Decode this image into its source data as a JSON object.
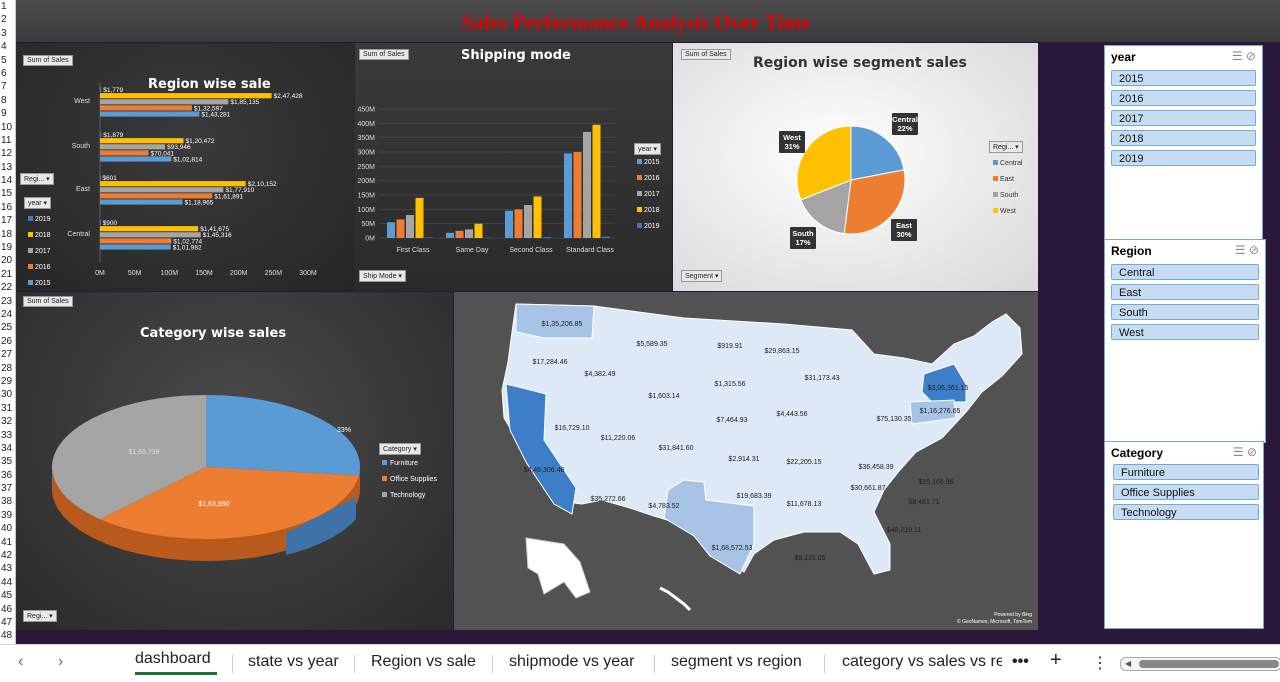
{
  "dashboard_title": "Sales Performance Analysis Over Time",
  "row_numbers": [
    "1",
    "2",
    "3",
    "4",
    "5",
    "6",
    "7",
    "8",
    "9",
    "10",
    "11",
    "12",
    "13",
    "14",
    "15",
    "16",
    "17",
    "18",
    "19",
    "20",
    "21",
    "22",
    "23",
    "24",
    "25",
    "26",
    "27",
    "28",
    "29",
    "30",
    "31",
    "32",
    "33",
    "34",
    "35",
    "36",
    "37",
    "38",
    "39",
    "40",
    "41",
    "42",
    "43",
    "44",
    "45",
    "46",
    "47",
    "48"
  ],
  "region_chart": {
    "field_button": "Sum of Sales",
    "title": "Region wise sale",
    "row_button": "Regi... ▾",
    "legend_button": "year ▾",
    "years": [
      "2019",
      "2018",
      "2017",
      "2016",
      "2015"
    ],
    "year_colors": {
      "2019": "#4472c4",
      "2018": "#ffc000",
      "2017": "#a5a5a5",
      "2016": "#ed7d31",
      "2015": "#5b9bd5"
    },
    "x_ticks": [
      "0M",
      "50M",
      "100M",
      "150M",
      "200M",
      "250M",
      "300M"
    ],
    "chart_data": {
      "type": "bar",
      "orientation": "horizontal",
      "categories": [
        "West",
        "South",
        "East",
        "Central"
      ],
      "series": [
        {
          "name": "2019",
          "values": [
            1779,
            1879,
            601,
            900
          ]
        },
        {
          "name": "2018",
          "values": [
            247428,
            120472,
            210152,
            141675
          ]
        },
        {
          "name": "2017",
          "values": [
            185135,
            93946,
            177910,
            145316
          ]
        },
        {
          "name": "2016",
          "values": [
            132597,
            70041,
            161891,
            102774
          ]
        },
        {
          "name": "2015",
          "values": [
            143281,
            102814,
            118965,
            101982
          ]
        }
      ],
      "labels": [
        [
          "$1,779",
          "$2,47,428",
          "$1,85,135",
          "$1,32,597",
          "$1,43,281"
        ],
        [
          "$1,879",
          "$1,20,472",
          "$93,946",
          "$70,041",
          "$1,02,814"
        ],
        [
          "$601",
          "$2,10,152",
          "$1,77,910",
          "$1,61,891",
          "$1,18,965"
        ],
        [
          "$900",
          "$1,41,675",
          "$1,45,316",
          "$1,02,774",
          "$1,01,982"
        ]
      ]
    }
  },
  "shipping_chart": {
    "field_button": "Sum of Sales",
    "title": "Shipping mode",
    "axis_button": "Ship Mode ▾",
    "legend_button": "year ▾",
    "y_ticks": [
      "0M",
      "50M",
      "100M",
      "150M",
      "200M",
      "250M",
      "300M",
      "350M",
      "400M",
      "450M"
    ],
    "legend": [
      "2015",
      "2016",
      "2017",
      "2018",
      "2019"
    ],
    "colors": [
      "#5b9bd5",
      "#ed7d31",
      "#a5a5a5",
      "#ffc000",
      "#4472c4"
    ],
    "chart_data": {
      "type": "bar",
      "categories": [
        "First Class",
        "Same Day",
        "Second Class",
        "Standard Class"
      ],
      "ylim": [
        0,
        450
      ],
      "series": [
        {
          "name": "2015",
          "values": [
            55,
            18,
            95,
            295
          ]
        },
        {
          "name": "2016",
          "values": [
            65,
            25,
            100,
            300
          ]
        },
        {
          "name": "2017",
          "values": [
            80,
            30,
            115,
            370
          ]
        },
        {
          "name": "2018",
          "values": [
            140,
            50,
            145,
            395
          ]
        },
        {
          "name": "2019",
          "values": [
            2,
            1,
            3,
            5
          ]
        }
      ]
    }
  },
  "segment_chart": {
    "field_button": "Sum of Sales",
    "title": "Region wise segment sales",
    "segment_button": "Segment ▾",
    "legend_button": "Regi... ▾",
    "chart_data": {
      "type": "pie",
      "categories": [
        "Central",
        "East",
        "South",
        "West"
      ],
      "values": [
        22,
        30,
        17,
        31
      ],
      "colors": [
        "#5b9bd5",
        "#ed7d31",
        "#a5a5a5",
        "#ffc000"
      ],
      "labels": [
        [
          "Central",
          "22%"
        ],
        [
          "East",
          "30%"
        ],
        [
          "South",
          "17%"
        ],
        [
          "West",
          "31%"
        ]
      ]
    }
  },
  "category_chart": {
    "field_button": "Sum of Sales",
    "title": "Category wise sales",
    "legend_button": "Category ▾",
    "row_button": "Regi... ▾",
    "chart_data": {
      "type": "pie",
      "categories": [
        "Furniture",
        "Office Supplies",
        "Technology"
      ],
      "values": [
        33,
        34,
        33
      ],
      "colors": [
        "#5b9bd5",
        "#ed7d31",
        "#a5a5a5"
      ],
      "labels": [
        "33%",
        "$1,63,590",
        "$1,68,739"
      ]
    }
  },
  "map": {
    "labels": [
      "$1,35,206.85",
      "$5,589.35",
      "$919.91",
      "$29,863.15",
      "$17,284.46",
      "$4,382.49",
      "$1,315.56",
      "$31,173.43",
      "$1,603.14",
      "$3,06,361.15",
      "$4,443.56",
      "$7,464.93",
      "$1,16,276.65",
      "$75,130.35",
      "$16,729.10",
      "$11,220.06",
      "$31,841.60",
      "$2,914.31",
      "$22,205.15",
      "$36,458.39",
      "$4,46,306.46",
      "$30,661.87",
      "$55,165.96",
      "$35,272.66",
      "$4,783.52",
      "$19,683.39",
      "$11,678.13",
      "$8,481.71",
      "$48,219.11",
      "$1,68,572.53",
      "$9,131.05"
    ],
    "attribution_1": "Powered by Bing",
    "attribution_2": "© GeoNames, Microsoft, TomTom"
  },
  "slicers": {
    "year": {
      "header": "year",
      "items": [
        "2015",
        "2016",
        "2017",
        "2018",
        "2019"
      ]
    },
    "region": {
      "header": "Region",
      "items": [
        "Central",
        "East",
        "South",
        "West"
      ]
    },
    "category": {
      "header": "Category",
      "items": [
        "Furniture",
        "Office Supplies",
        "Technology"
      ]
    }
  },
  "tabs": [
    "dashboard",
    "state vs year",
    "Region vs sale",
    "shipmode vs year",
    "segment vs region",
    "category vs sales vs re"
  ],
  "active_tab": "dashboard"
}
